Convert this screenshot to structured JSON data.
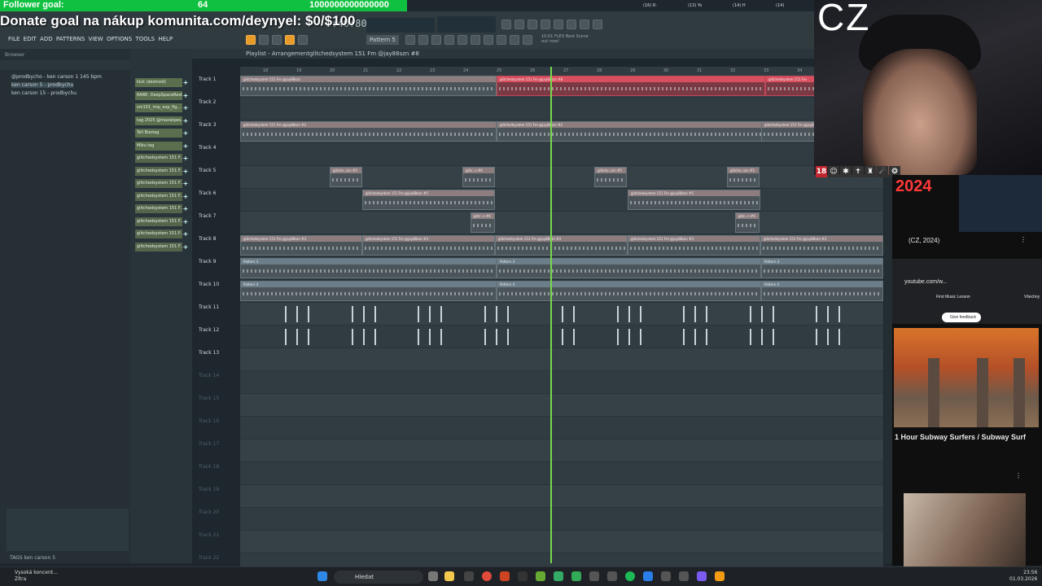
{
  "overlay": {
    "follower_goal": "Follower goal:",
    "follower_count": "64",
    "big_number": "1000000000000000",
    "donate_goal": "Donate goal na nákup komunita.com/deynyel: $0/$100"
  },
  "fl": {
    "menu": [
      "FILE",
      "EDIT",
      "ADD",
      "PATTERNS",
      "VIEW",
      "OPTIONS",
      "TOOLS",
      "HELP"
    ],
    "time": "0:40:80",
    "pattern": "Pattern 5",
    "hint": "10:01 FLEX Best Scene out now!",
    "playlist_title": "Playlist - Arrangement",
    "playlist_clip": "glitchedsystem 151 Fm @jay88szn #8",
    "browser_label": "Browser",
    "browser_items": [
      "@prodbycho - ken carson 1 145 bpm",
      "ken carson 5 - prodbychu",
      "ken carson 15 - prodbychu"
    ],
    "tags_label": "TAGS",
    "tags_value": "ken carson 5"
  },
  "channels": [
    "kick (destroid)",
    "RARE- DeepSpaceRest...",
    "sm101_imp_exp_fig...",
    "tag 2025 @maxwipes...",
    "Tell Bootag",
    "Miku tag",
    "glitchedsystem 151 F...",
    "glitchedsystem 151 F...",
    "glitchedsystem 151 F...",
    "glitchedsystem 151 F...",
    "glitchedsystem 151 F...",
    "glitchedsystem 151 F...",
    "glitchedsystem 151 F...",
    "glitchedsystem 151 F..."
  ],
  "ruler_ticks": [
    "18",
    "19",
    "20",
    "21",
    "22",
    "23",
    "24",
    "25",
    "26",
    "27",
    "28",
    "29",
    "30",
    "31",
    "32",
    "33",
    "34"
  ],
  "tracks": [
    "Track 1",
    "Track 2",
    "Track 3",
    "Track 4",
    "Track 5",
    "Track 6",
    "Track 7",
    "Track 8",
    "Track 9",
    "Track 10",
    "Track 11",
    "Track 12",
    "Track 13",
    "Track 14",
    "Track 15",
    "Track 16",
    "Track 17",
    "Track 18",
    "Track 19",
    "Track 20",
    "Track 21",
    "Track 22"
  ],
  "clip_labels": {
    "glitch": "glitchedsystem 151 Fm @jay88szn",
    "glitch8": "glitchedsystem 151 Fm @jay88szn #8",
    "glitch2": "glitchedsystem 151 Fm @jay88szn #2",
    "glitch3": "glitchedsystem 151 Fm @jay88szn #3",
    "glitch5": "glitchedsystem 151 Fm @jay88szn #5",
    "glitchsm": "glitche..szn #5",
    "glitchsm6": "glitc..n #6",
    "pattern3": "Pattern 3",
    "pattern4": "Pattern 4",
    "t1_end": "glitchedsystem 151 Fm"
  },
  "stream": {
    "cz": "CZ",
    "year": "2024",
    "cz_year": "(CZ, 2024)",
    "url": "youtube.com/w...",
    "first_music": "First Music Lesson",
    "feedback": "Give feedback",
    "video_title": "1 Hour Subway Surfers / Subway Surf",
    "bookmark": "Všechny"
  },
  "taskbar": {
    "notif_title": "Vysoká koncent...",
    "notif_sub": "Zítra",
    "search": "Hledat",
    "time": "23:56",
    "date": "01.03.2026"
  }
}
